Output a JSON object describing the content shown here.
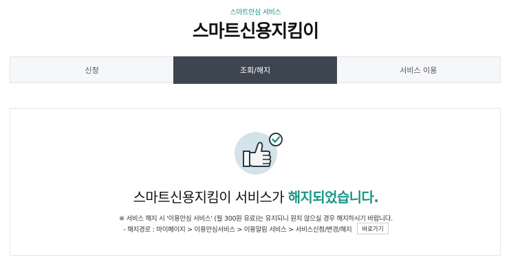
{
  "header": {
    "kicker": "스마트안심 서비스",
    "title": "스마트신용지킴이"
  },
  "tabs": [
    {
      "label": "신청",
      "active": false
    },
    {
      "label": "조회/해지",
      "active": true
    },
    {
      "label": "서비스 이용",
      "active": false
    }
  ],
  "result": {
    "icon": "thumbs-up-check-icon",
    "headline_prefix": "스마트신용지킴이 서비스가 ",
    "headline_accent": "해지되었습니다.",
    "note": "※ 서비스 해지 시 '이용안심 서비스' (월 300원 유료)는 유지되니 원치 않으실 경우 해지하시기 바랍니다.",
    "path_text": "- 해지경로 : 마이페이지 > 이용안심서비스 > 이용알림 서비스 > 서비스신청/변경/해지",
    "go_button_label": "바로가기"
  },
  "colors": {
    "accent": "#1a9584",
    "tab_active_bg": "#3d4550",
    "icon_circle": "#d4e3ea"
  }
}
